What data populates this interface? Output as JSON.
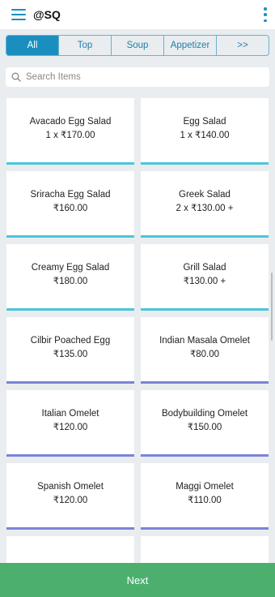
{
  "header": {
    "title": "@SQ",
    "menu_icon": "hamburger-menu-icon",
    "more_icon": "more-vert-icon",
    "accent_color": "#1a8fbf"
  },
  "tabs": [
    {
      "label": "All",
      "active": true
    },
    {
      "label": "Top",
      "active": false
    },
    {
      "label": "Soup",
      "active": false
    },
    {
      "label": "Appetizer",
      "active": false
    },
    {
      "label": ">>",
      "active": false
    }
  ],
  "search": {
    "placeholder": "Search Items",
    "value": "",
    "icon": "search-icon"
  },
  "items": [
    {
      "name": "Avacado Egg Salad",
      "price": "1 x  ₹170.00",
      "bar_color": "#4cc6dc"
    },
    {
      "name": "Egg Salad",
      "price": "1 x  ₹140.00",
      "bar_color": "#4cc6dc"
    },
    {
      "name": "Sriracha Egg Salad",
      "price": "₹160.00",
      "bar_color": "#4cc6dc"
    },
    {
      "name": "Greek Salad",
      "price": "2 x  ₹130.00 +",
      "bar_color": "#4cc6dc"
    },
    {
      "name": "Creamy Egg Salad",
      "price": "₹180.00",
      "bar_color": "#4cc6dc"
    },
    {
      "name": "Grill Salad",
      "price": "₹130.00 +",
      "bar_color": "#4cc6dc"
    },
    {
      "name": "Cilbir Poached Egg",
      "price": "₹135.00",
      "bar_color": "#7b84d6"
    },
    {
      "name": "Indian Masala Omelet",
      "price": "₹80.00",
      "bar_color": "#7b84d6"
    },
    {
      "name": "Italian Omelet",
      "price": "₹120.00",
      "bar_color": "#7b84d6"
    },
    {
      "name": "Bodybuilding Omelet",
      "price": "₹150.00",
      "bar_color": "#7b84d6"
    },
    {
      "name": "Spanish Omelet",
      "price": "₹120.00",
      "bar_color": "#7b84d6"
    },
    {
      "name": "Maggi Omelet",
      "price": "₹110.00",
      "bar_color": "#7b84d6"
    },
    {
      "name": "",
      "price": "",
      "bar_color": "#7b84d6"
    },
    {
      "name": "",
      "price": "",
      "bar_color": "#7b84d6"
    }
  ],
  "footer": {
    "next_label": "Next",
    "button_color": "#4caf6e"
  }
}
